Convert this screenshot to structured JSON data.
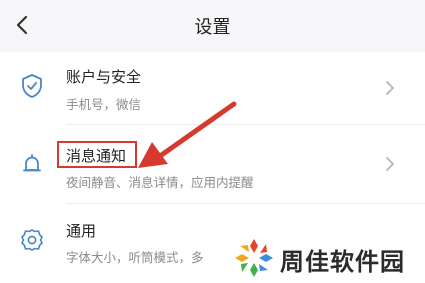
{
  "header": {
    "title": "设置",
    "back_icon": "chevron-left-icon"
  },
  "items": [
    {
      "title": "账户与安全",
      "subtitle": "手机号，微信",
      "icon": "shield-check-icon"
    },
    {
      "title": "消息通知",
      "subtitle": "夜间静音、消息详情，应用内提醒",
      "icon": "bell-icon"
    },
    {
      "title": "通用",
      "subtitle": "字体大小，听筒模式，多",
      "icon": "gear-icon"
    }
  ],
  "annotation": {
    "color": "#d8392f"
  },
  "watermark": {
    "text": "周佳软件园"
  }
}
